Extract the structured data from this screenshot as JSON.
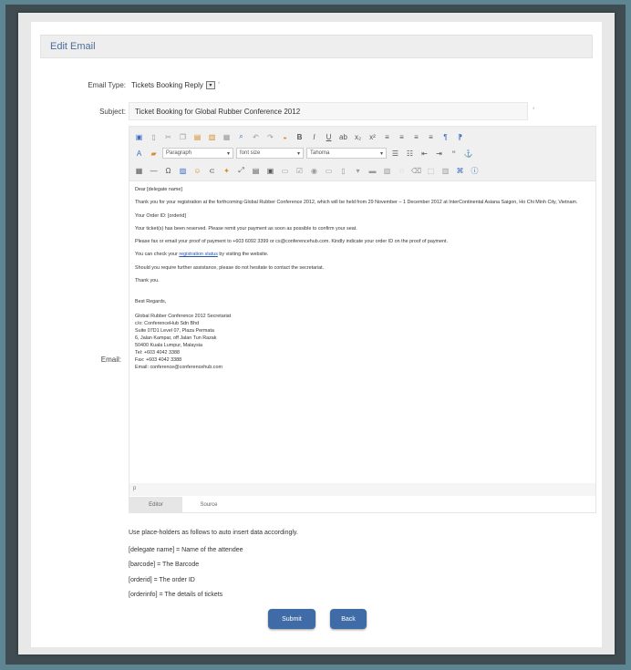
{
  "header": {
    "title": "Edit Email"
  },
  "form": {
    "email_type_label": "Email Type:",
    "email_type_value": "Tickets Booking Reply",
    "subject_label": "Subject:",
    "subject_value": "Ticket Booking for Global Rubber Conference 2012",
    "email_label": "Email:"
  },
  "toolbar": {
    "format_select": "Paragraph",
    "size_select": "font size",
    "font_select": "Tahoma"
  },
  "email_body": {
    "greeting": "Dear [delegate name]",
    "para1": "Thank you for your registration at the forthcoming Global Rubber Conference 2012, which will be held from 29 November – 1 December 2012 at InterContinental Asiana Saigon, Ho Chi Minh City, Vietnam.",
    "para2": "Your Order ID: [orderid]",
    "para3": "Your ticket(s) has been reserved. Please remit your payment as soon as possible to confirm your seat.",
    "para4": "Please fax or email your proof of payment to +603 6092 3399 or cs@conferencehub.com. Kindly indicate your order ID on the proof of payment.",
    "para5_pre": "You can check your ",
    "para5_link": "registration status",
    "para5_post": " by visiting the website.",
    "para6": "Should you require further assistance, please do not hesitate to contact the secretariat.",
    "para7": "Thank you.",
    "closing": "Best Regards,",
    "sig1": "Global Rubber Conference 2012 Secretariat",
    "sig2": "c/o: ConferenceHub Sdn Bhd",
    "sig3": "Suite 07D1 Level 07, Plaza Permata",
    "sig4": "6, Jalan Kampar, off Jalan Tun Razak",
    "sig5": "50400 Kuala Lumpur, Malaysia",
    "sig6": "Tel: +603 4042 3388",
    "sig7": "Fax: +603 4042 3388",
    "sig8": "Email: conference@conferencehub.com"
  },
  "status_bar": {
    "path": "p"
  },
  "editor_tabs": {
    "editor": "Editor",
    "source": "Source"
  },
  "help": {
    "intro": "Use place-holders as follows to auto insert data accordingly.",
    "item1": "[delegate name] = Name of the attendee",
    "item2": "[barcode] = The Barcode",
    "item3": "[orderid] = The order ID",
    "item4": "[orderinfo] = The details of tickets"
  },
  "buttons": {
    "submit": "Submit",
    "back": "Back"
  },
  "colors": {
    "accent": "#3f6ca6",
    "header_text": "#4b6e9a"
  }
}
